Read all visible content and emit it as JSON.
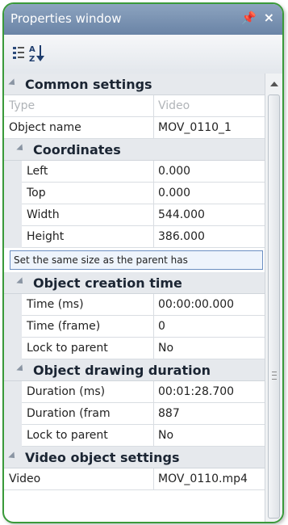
{
  "window": {
    "title": "Properties window",
    "pin_glyph": "ऩ",
    "close_glyph": "×"
  },
  "toolbar": {
    "buttons": [
      {
        "name": "categorized-view-icon"
      },
      {
        "name": "alphabetical-sort-icon"
      }
    ]
  },
  "grid": {
    "common_settings": {
      "label": "Common settings",
      "type": {
        "name": "Type",
        "value": "Video"
      },
      "object_name": {
        "name": "Object name",
        "value": "MOV_0110_1"
      }
    },
    "coordinates": {
      "label": "Coordinates",
      "left": {
        "name": "Left",
        "value": "0.000"
      },
      "top": {
        "name": "Top",
        "value": "0.000"
      },
      "width": {
        "name": "Width",
        "value": "544.000"
      },
      "height": {
        "name": "Height",
        "value": "386.000"
      },
      "action": "Set the same size as the parent has"
    },
    "creation_time": {
      "label": "Object creation time",
      "time_ms": {
        "name": "Time (ms)",
        "value": "00:00:00.000"
      },
      "time_frame": {
        "name": "Time (frame)",
        "value": "0"
      },
      "lock": {
        "name": "Lock to parent",
        "value": "No"
      }
    },
    "drawing_duration": {
      "label": "Object drawing duration",
      "duration_ms": {
        "name": "Duration (ms)",
        "value": "00:01:28.700"
      },
      "duration_frame": {
        "name": "Duration (fram",
        "value": "887"
      },
      "lock": {
        "name": "Lock to parent",
        "value": "No"
      }
    },
    "video_settings": {
      "label": "Video object settings",
      "video": {
        "name": "Video",
        "value": "MOV_0110.mp4"
      }
    }
  },
  "colors": {
    "frame_border": "#3a9a3a",
    "titlebar": "#7890b0",
    "category_bg": "#e6e9ed",
    "action_border": "#6c8fc2"
  }
}
